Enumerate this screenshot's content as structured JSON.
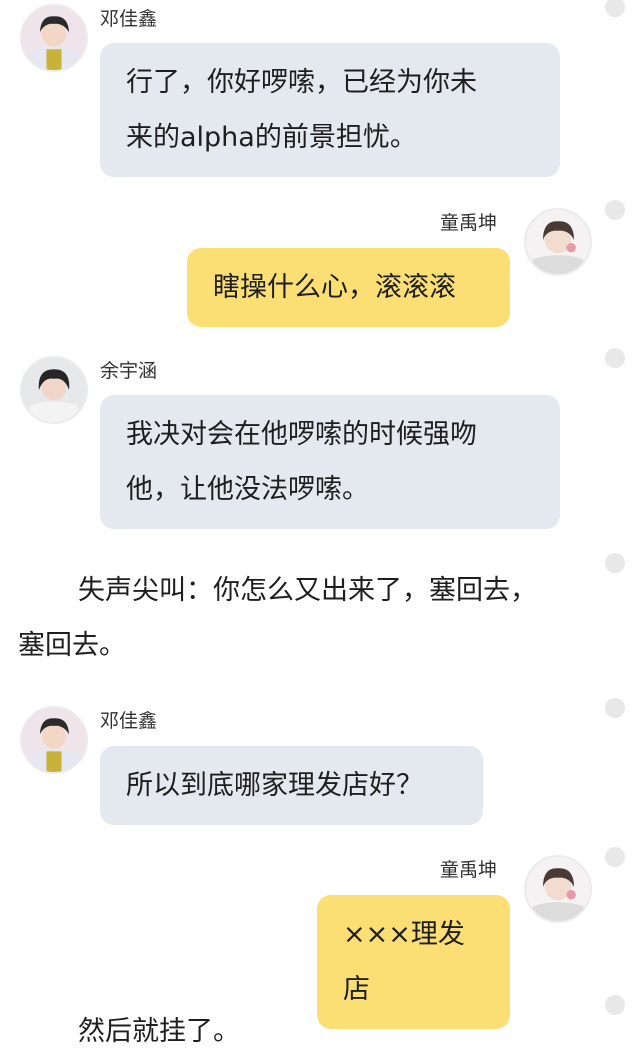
{
  "messages": [
    {
      "side": "left",
      "sender": "邓佳鑫",
      "lines": [
        "行了，你好啰嗦，已经为你未",
        "来的alpha的前景担忧。"
      ]
    },
    {
      "side": "right",
      "sender": "童禹坤",
      "lines": [
        "瞎操什么心，滚滚滚"
      ]
    },
    {
      "side": "left",
      "sender": "余宇涵",
      "lines": [
        "我决对会在他啰嗦的时候强吻",
        "他，让他没法啰嗦。"
      ]
    },
    {
      "narration_lines": [
        "失声尖叫：你怎么又出来了，塞回去，",
        "塞回去。"
      ]
    },
    {
      "side": "left",
      "sender": "邓佳鑫",
      "lines": [
        "所以到底哪家理发店好？"
      ]
    },
    {
      "side": "right",
      "sender": "童禹坤",
      "lines": [
        "×××理发店"
      ]
    },
    {
      "narration_lines": [
        "然后就挂了。"
      ]
    }
  ],
  "colors": {
    "received_bubble": "#e4e8ef",
    "sent_bubble": "#fbdf74",
    "options_dot": "#e8e8e8"
  },
  "icons": [
    "avatar-dengjiaxin",
    "avatar-tongyukun",
    "avatar-yuyuhan",
    "more-options-dot"
  ]
}
